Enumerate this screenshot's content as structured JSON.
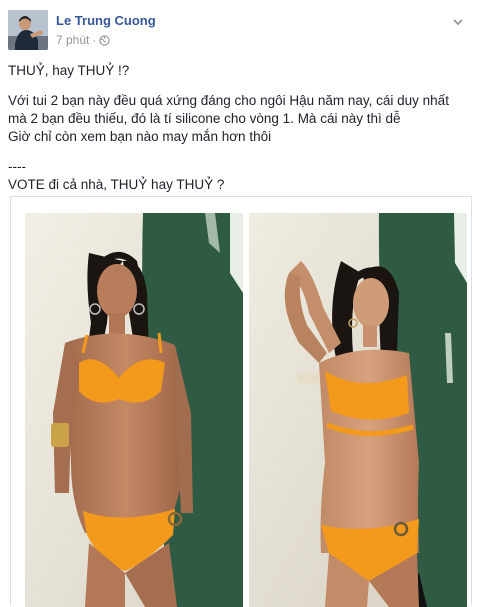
{
  "post": {
    "author": "Le Trung Cuong",
    "time": "7 phút",
    "separator": "·",
    "privacy_icon": "globe-icon",
    "menu_icon": "chevron-down-icon",
    "text_lines": [
      "THUỶ, hay THUỶ !?",
      "Với tui 2 bạn này đều quá xứng đáng cho ngôi Hậu năm nay, cái duy nhất",
      "mà 2 bạn đều thiếu, đó là tí silicone cho vòng 1. Mà cái này thì dễ",
      "Giờ chỉ còn xem bạn nào may mắn hơn thôi",
      "----",
      "VOTE đi cả nhà, THUỶ hay THUỶ ?"
    ],
    "photos": [
      {
        "name": "photo-left",
        "subject": "woman in orange bikini, standing, front view"
      },
      {
        "name": "photo-right",
        "subject": "woman in orange bikini, posing with arm raised"
      }
    ]
  },
  "colors": {
    "author_link": "#365899",
    "meta_text": "#90949c",
    "body_text": "#1d2129",
    "bikini_orange": "#f39a1c",
    "surfboard_green": "#2f5a43"
  }
}
